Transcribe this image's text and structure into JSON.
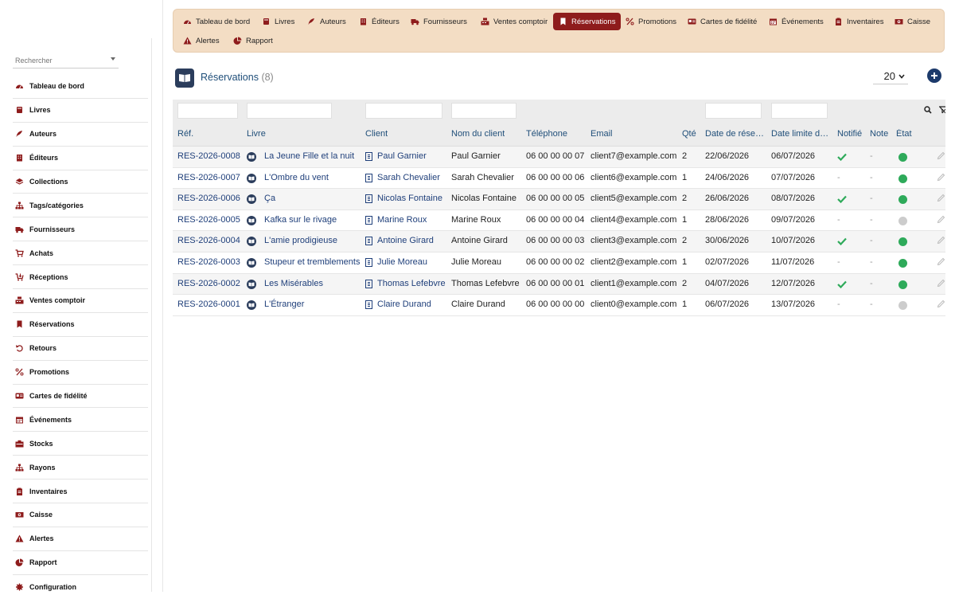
{
  "sidebar": {
    "search_placeholder": "Rechercher",
    "items": [
      {
        "label": "Tableau de bord",
        "icon": "dashboard-icon"
      },
      {
        "label": "Livres",
        "icon": "book-icon"
      },
      {
        "label": "Auteurs",
        "icon": "feather-icon"
      },
      {
        "label": "Éditeurs",
        "icon": "building-icon"
      },
      {
        "label": "Collections",
        "icon": "layers-icon"
      },
      {
        "label": "Tags/catégories",
        "icon": "sitemap-icon"
      },
      {
        "label": "Fournisseurs",
        "icon": "truck-icon"
      },
      {
        "label": "Achats",
        "icon": "cart-icon"
      },
      {
        "label": "Réceptions",
        "icon": "receive-icon"
      },
      {
        "label": "Ventes comptoir",
        "icon": "cash-register-icon"
      },
      {
        "label": "Réservations",
        "icon": "bookmark-icon"
      },
      {
        "label": "Retours",
        "icon": "undo-icon"
      },
      {
        "label": "Promotions",
        "icon": "percent-icon"
      },
      {
        "label": "Cartes de fidélité",
        "icon": "card-icon"
      },
      {
        "label": "Événements",
        "icon": "calendar-icon"
      },
      {
        "label": "Stocks",
        "icon": "box-icon"
      },
      {
        "label": "Rayons",
        "icon": "sitemap-icon"
      },
      {
        "label": "Inventaires",
        "icon": "clipboard-icon"
      },
      {
        "label": "Caisse",
        "icon": "money-icon"
      },
      {
        "label": "Alertes",
        "icon": "warning-icon"
      },
      {
        "label": "Rapport",
        "icon": "pie-chart-icon"
      },
      {
        "label": "Configuration",
        "icon": "gear-icon"
      }
    ]
  },
  "topnav": {
    "tabs": [
      {
        "label": "Tableau de bord",
        "icon": "dashboard-icon"
      },
      {
        "label": "Livres",
        "icon": "book-icon"
      },
      {
        "label": "Auteurs",
        "icon": "feather-icon"
      },
      {
        "label": "Éditeurs",
        "icon": "building-icon"
      },
      {
        "label": "Fournisseurs",
        "icon": "truck-icon"
      },
      {
        "label": "Ventes comptoir",
        "icon": "cash-register-icon"
      },
      {
        "label": "Réservations",
        "icon": "bookmark-icon",
        "active": true
      },
      {
        "label": "Promotions",
        "icon": "percent-icon"
      },
      {
        "label": "Cartes de fidélité",
        "icon": "card-icon"
      },
      {
        "label": "Événements",
        "icon": "calendar-icon"
      },
      {
        "label": "Inventaires",
        "icon": "clipboard-icon"
      },
      {
        "label": "Caisse",
        "icon": "money-icon"
      },
      {
        "label": "Alertes",
        "icon": "warning-icon"
      },
      {
        "label": "Rapport",
        "icon": "pie-chart-icon"
      }
    ]
  },
  "header": {
    "title": "Réservations",
    "count": "(8)",
    "page_size": "20"
  },
  "colors": {
    "nav_bg": "#f3ddc4",
    "active_tab": "#8e1c1c",
    "link": "#1f3f7a",
    "status_green": "#2eaa5a",
    "status_grey": "#cccccc"
  },
  "table": {
    "columns": [
      "Réf.",
      "Livre",
      "Client",
      "Nom du client",
      "Téléphone",
      "Email",
      "Qté",
      "Date de réservation",
      "Date limite de retrait",
      "Notifié",
      "Note",
      "État"
    ],
    "columns_display": [
      "Réf.",
      "Livre",
      "Client",
      "Nom du client",
      "Téléphone",
      "Email",
      "Qté",
      "Date de rése…",
      "Date limite d…",
      "Notifié",
      "Note",
      "État"
    ],
    "rows": [
      {
        "ref": "RES-2026-0008",
        "book": "La Jeune Fille et la nuit",
        "client": "Paul Garnier",
        "name": "Paul Garnier",
        "phone": "06 00 00 00 07",
        "email": "client7@example.com",
        "qty": "2",
        "date": "22/06/2026",
        "limit": "06/07/2026",
        "notified": true,
        "note": "-",
        "state": "green"
      },
      {
        "ref": "RES-2026-0007",
        "book": "L'Ombre du vent",
        "client": "Sarah Chevalier",
        "name": "Sarah Chevalier",
        "phone": "06 00 00 00 06",
        "email": "client6@example.com",
        "qty": "1",
        "date": "24/06/2026",
        "limit": "07/07/2026",
        "notified": false,
        "note": "-",
        "state": "green"
      },
      {
        "ref": "RES-2026-0006",
        "book": "Ça",
        "client": "Nicolas Fontaine",
        "name": "Nicolas Fontaine",
        "phone": "06 00 00 00 05",
        "email": "client5@example.com",
        "qty": "2",
        "date": "26/06/2026",
        "limit": "08/07/2026",
        "notified": true,
        "note": "-",
        "state": "green"
      },
      {
        "ref": "RES-2026-0005",
        "book": "Kafka sur le rivage",
        "client": "Marine Roux",
        "name": "Marine Roux",
        "phone": "06 00 00 00 04",
        "email": "client4@example.com",
        "qty": "1",
        "date": "28/06/2026",
        "limit": "09/07/2026",
        "notified": false,
        "note": "-",
        "state": "grey"
      },
      {
        "ref": "RES-2026-0004",
        "book": "L'amie prodigieuse",
        "client": "Antoine Girard",
        "name": "Antoine Girard",
        "phone": "06 00 00 00 03",
        "email": "client3@example.com",
        "qty": "2",
        "date": "30/06/2026",
        "limit": "10/07/2026",
        "notified": true,
        "note": "-",
        "state": "green"
      },
      {
        "ref": "RES-2026-0003",
        "book": "Stupeur et tremblements",
        "client": "Julie Moreau",
        "name": "Julie Moreau",
        "phone": "06 00 00 00 02",
        "email": "client2@example.com",
        "qty": "1",
        "date": "02/07/2026",
        "limit": "11/07/2026",
        "notified": false,
        "note": "-",
        "state": "green"
      },
      {
        "ref": "RES-2026-0002",
        "book": "Les Misérables",
        "client": "Thomas Lefebvre",
        "name": "Thomas Lefebvre",
        "phone": "06 00 00 00 01",
        "email": "client1@example.com",
        "qty": "2",
        "date": "04/07/2026",
        "limit": "12/07/2026",
        "notified": true,
        "note": "-",
        "state": "green"
      },
      {
        "ref": "RES-2026-0001",
        "book": "L'Étranger",
        "client": "Claire Durand",
        "name": "Claire Durand",
        "phone": "06 00 00 00 00",
        "email": "client0@example.com",
        "qty": "1",
        "date": "06/07/2026",
        "limit": "13/07/2026",
        "notified": false,
        "note": "-",
        "state": "grey"
      }
    ]
  }
}
